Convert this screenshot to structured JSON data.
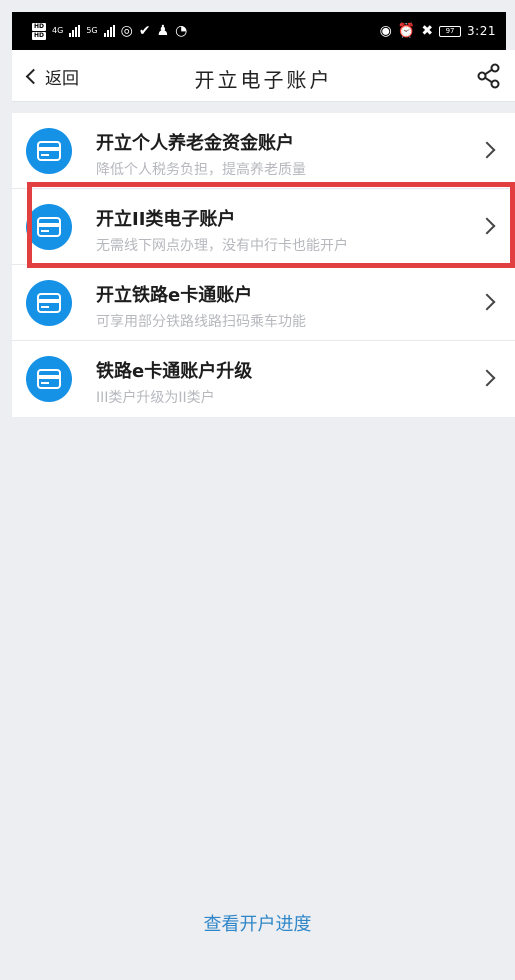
{
  "status_bar": {
    "hd_badge_1": "HD",
    "hd_badge_2": "HD",
    "network_4g": "4G",
    "network_5g": "5G",
    "battery": "97",
    "time": "3:21"
  },
  "nav": {
    "back_label": "返回",
    "title": "开立电子账户",
    "share_icon": "share-icon"
  },
  "items": [
    {
      "title": "开立个人养老金资金账户",
      "subtitle": "降低个人税务负担，提高养老质量",
      "icon": "card-icon"
    },
    {
      "title": "开立II类电子账户",
      "subtitle": "无需线下网点办理，没有中行卡也能开户",
      "icon": "card-icon",
      "highlighted": true
    },
    {
      "title": "开立铁路e卡通账户",
      "subtitle": "可享用部分铁路线路扫码乘车功能",
      "icon": "card-icon"
    },
    {
      "title": "铁路e卡通账户升级",
      "subtitle": "III类户升级为II类户",
      "icon": "card-icon"
    }
  ],
  "footer": {
    "progress_link": "查看开户进度"
  },
  "colors": {
    "accent_blue": "#1592e6",
    "link_blue": "#2f87c9",
    "highlight_red": "#e24040",
    "background": "#eceef2"
  }
}
